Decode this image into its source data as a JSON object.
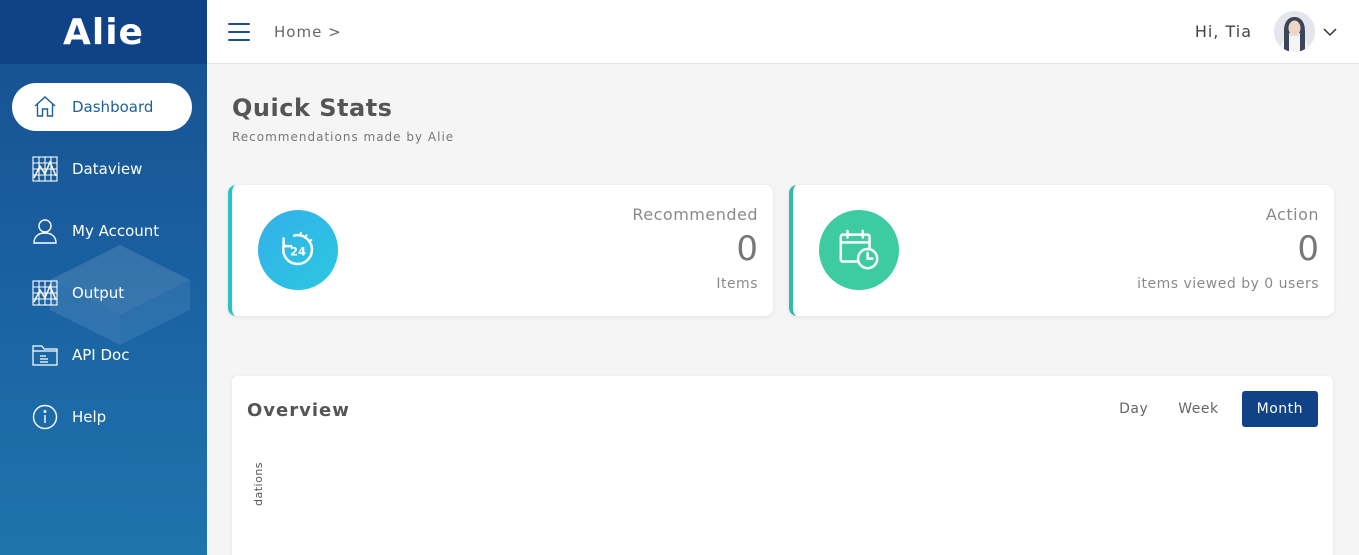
{
  "app": {
    "logo": "Alie"
  },
  "sidebar": {
    "items": [
      {
        "label": "Dashboard",
        "icon": "home-icon",
        "active": true
      },
      {
        "label": "Dataview",
        "icon": "grid-chart-icon"
      },
      {
        "label": "My Account",
        "icon": "user-icon"
      },
      {
        "label": "Output",
        "icon": "grid-chart-icon"
      },
      {
        "label": "API Doc",
        "icon": "folder-icon"
      },
      {
        "label": "Help",
        "icon": "info-icon"
      }
    ]
  },
  "header": {
    "breadcrumb": "Home >",
    "greeting": "Hi, Tia"
  },
  "main": {
    "title": "Quick Stats",
    "subtitle": "Recommendations made by Alie",
    "stats": [
      {
        "label": "Recommended",
        "value": "0",
        "unit": "Items",
        "icon": "24-hours-icon",
        "color": "#33b0ea"
      },
      {
        "label": "Action",
        "value": "0",
        "unit": "items viewed by 0 users",
        "icon": "calendar-clock-icon",
        "color": "#3dcba1"
      }
    ],
    "overview": {
      "title": "Overview",
      "periods": [
        "Day",
        "Week",
        "Month"
      ],
      "active_period": "Month",
      "y_axis_label": "dations"
    }
  },
  "colors": {
    "brand_dark": "#0f4287",
    "sidebar_gradient_end": "#1e74ad",
    "accent_teal": "#2bc4c6"
  }
}
